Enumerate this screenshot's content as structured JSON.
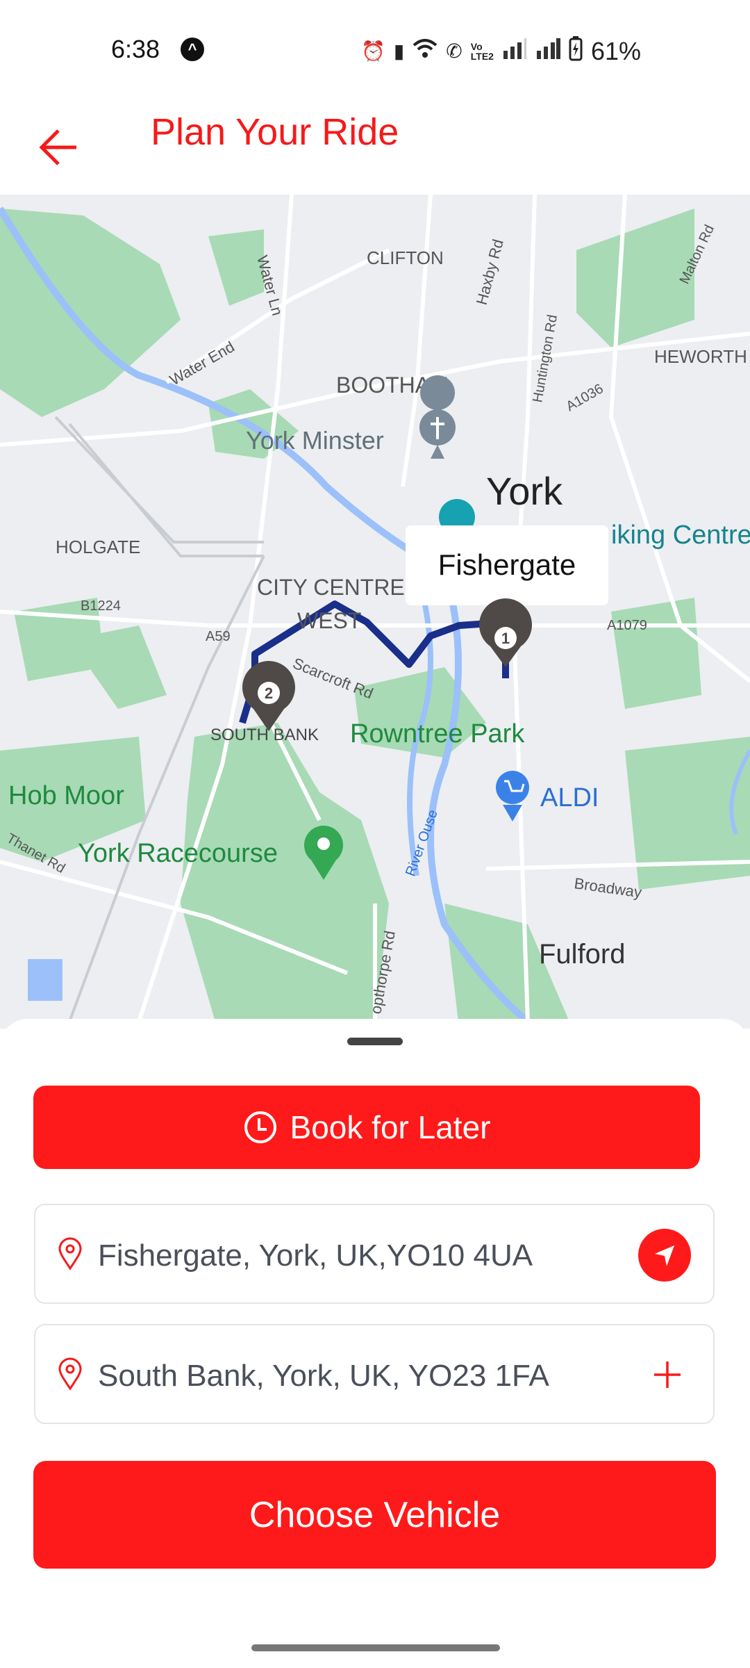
{
  "status_bar": {
    "time": "6:38",
    "battery": "61%",
    "icons": [
      "app-notification-icon",
      "alarm-icon",
      "vibrate-icon",
      "wifi-icon",
      "wifi-calling-icon",
      "volte-icon",
      "signal-icon",
      "signal-icon",
      "battery-charging-icon"
    ]
  },
  "header": {
    "title": "Plan Your Ride",
    "back_icon": "arrow-left-icon"
  },
  "map": {
    "labels": {
      "clifton": "CLIFTON",
      "water_ln": "Water Ln",
      "haxby_rd": "Haxby Rd",
      "malton_rd": "Malton Rd",
      "huntington_rd": "Huntington Rd",
      "heworth": "HEWORTH",
      "water_end": "Water End",
      "bootham": "BOOTHAM",
      "a1036": "A1036",
      "york_minster": "York Minster",
      "york": "York",
      "viking_centre": "iking Centre",
      "holgate": "HOLGATE",
      "city_centre": "CITY CENTRE",
      "west": "WEST",
      "b1224": "B1224",
      "a59": "A59",
      "a1079": "A1079",
      "scarcroft_rd": "Scarcroft Rd",
      "south_bank": "SOUTH BANK",
      "rowntree_park": "Rowntree Park",
      "hob_moor": "Hob Moor",
      "aldi": "ALDI",
      "thanet_rd": "Thanet Rd",
      "york_racecourse": "York Racecourse",
      "river_ouse": "River Ouse",
      "broadway": "Broadway",
      "bishopthorpe_rd": "opthorpe Rd",
      "fulford": "Fulford"
    },
    "callout": "Fishergate",
    "markers": [
      {
        "label": "1"
      },
      {
        "label": "2"
      }
    ],
    "colors": {
      "route": "#1a2f8a",
      "park": "#a8dab5",
      "water": "#9cc0f9",
      "road": "#ffffff",
      "land": "#eceef1",
      "marker": "#4f4a47"
    }
  },
  "sheet": {
    "book_later": "Book for Later",
    "pickup": "Fishergate, York, UK,YO10 4UA",
    "dropoff": "South Bank, York, UK, YO23 1FA",
    "choose_vehicle": "Choose Vehicle"
  },
  "colors": {
    "accent": "#fe1a1a",
    "title": "#f51a1a",
    "field_text": "#4a4f5a"
  }
}
